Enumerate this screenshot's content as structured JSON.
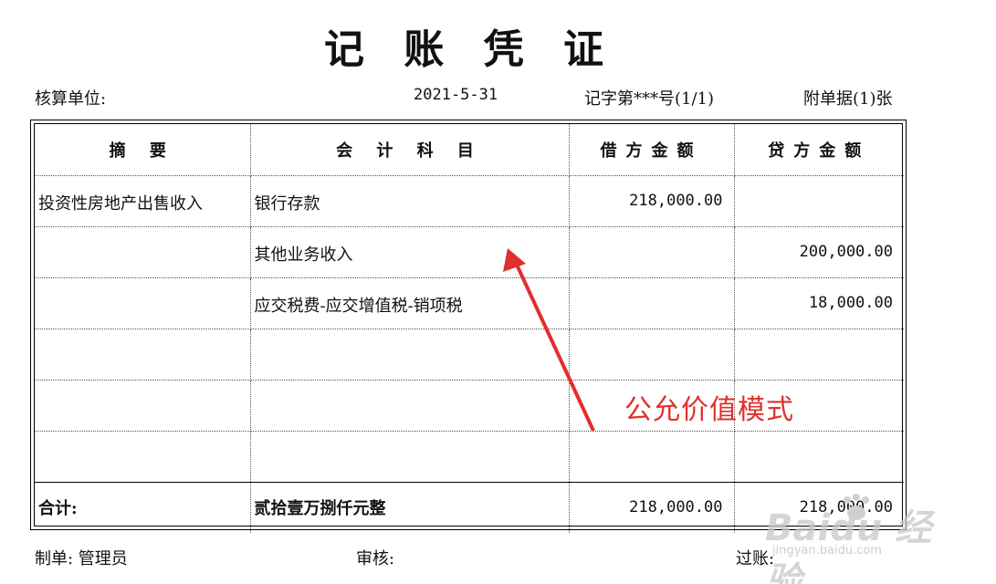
{
  "title": "记 账 凭 证",
  "header": {
    "unit_label": "核算单位:",
    "date": "2021-5-31",
    "voucher_no": "记字第***号(1/1)",
    "attachments": "附单据(1)张"
  },
  "table": {
    "headers": [
      "摘 要",
      "会 计 科 目",
      "借方金额",
      "贷方金额"
    ],
    "rows": [
      {
        "summary": "投资性房地产出售收入",
        "account": "银行存款",
        "debit": "218,000.00",
        "credit": ""
      },
      {
        "summary": "",
        "account": "其他业务收入",
        "debit": "",
        "credit": "200,000.00"
      },
      {
        "summary": "",
        "account": "应交税费-应交增值税-销项税",
        "debit": "",
        "credit": "18,000.00"
      },
      {
        "summary": "",
        "account": "",
        "debit": "",
        "credit": ""
      },
      {
        "summary": "",
        "account": "",
        "debit": "",
        "credit": ""
      },
      {
        "summary": "",
        "account": "",
        "debit": "",
        "credit": ""
      }
    ],
    "total": {
      "label": "合计:",
      "amount_words": "贰拾壹万捌仟元整",
      "debit": "218,000.00",
      "credit": "218,000.00"
    }
  },
  "footer": {
    "maker": "制单: 管理员",
    "reviewer": "审核:",
    "poster": "过账:"
  },
  "annotation": {
    "text": "公允价值模式",
    "color": "#e0302c"
  },
  "watermark": {
    "brand": "Baidu 经验",
    "url": "jingyan.baidu.com"
  }
}
